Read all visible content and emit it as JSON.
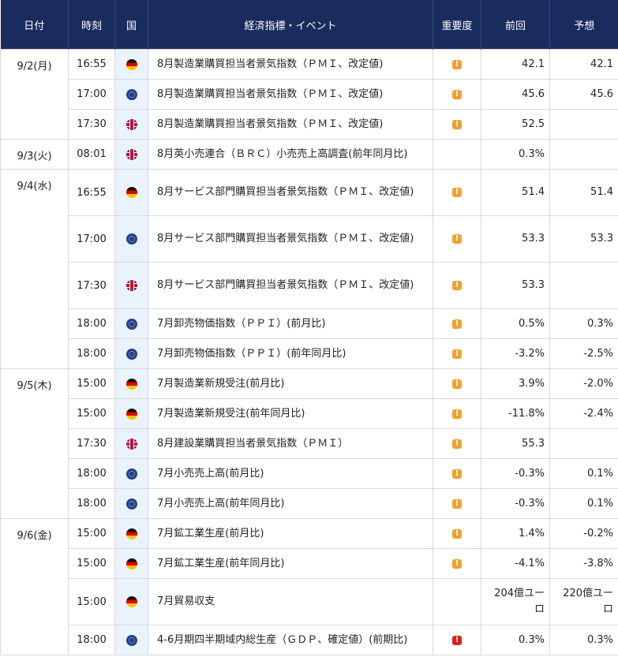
{
  "header": {
    "date": "日付",
    "time": "時刻",
    "country": "国",
    "event": "経済指標・イベント",
    "importance": "重要度",
    "previous": "前回",
    "forecast": "予想"
  },
  "importance_glyph": "!",
  "colors": {
    "header_bg": "#1a2b5e",
    "flag_column_bg": "#eaf3fb",
    "importance_medium": "#f0a030",
    "importance_high": "#e0201a"
  },
  "days": [
    {
      "date": "9/2(月)",
      "rows": [
        {
          "time": "16:55",
          "country": "germany-flag-icon",
          "event": "8月製造業購買担当者景気指数（ＰＭＩ、改定値)",
          "importance": "medium",
          "previous": "42.1",
          "forecast": "42.1"
        },
        {
          "time": "17:00",
          "country": "eu-flag-icon",
          "event": "8月製造業購買担当者景気指数（ＰＭＩ、改定値)",
          "importance": "medium",
          "previous": "45.6",
          "forecast": "45.6"
        },
        {
          "time": "17:30",
          "country": "uk-flag-icon",
          "event": "8月製造業購買担当者景気指数（ＰＭＩ、改定値)",
          "importance": "medium",
          "previous": "52.5",
          "forecast": ""
        }
      ]
    },
    {
      "date": "9/3(火)",
      "rows": [
        {
          "time": "08:01",
          "country": "uk-flag-icon",
          "event": "8月英小売連合（ＢＲＣ）小売売上高調査(前年同月比)",
          "importance": "",
          "previous": "0.3%",
          "forecast": ""
        }
      ]
    },
    {
      "date": "9/4(水)",
      "rows": [
        {
          "time": "16:55",
          "country": "germany-flag-icon",
          "event": "8月サービス部門購買担当者景気指数（ＰＭＩ、改定値)",
          "importance": "medium",
          "previous": "51.4",
          "forecast": "51.4"
        },
        {
          "time": "17:00",
          "country": "eu-flag-icon",
          "event": "8月サービス部門購買担当者景気指数（ＰＭＩ、改定値)",
          "importance": "medium",
          "previous": "53.3",
          "forecast": "53.3"
        },
        {
          "time": "17:30",
          "country": "uk-flag-icon",
          "event": "8月サービス部門購買担当者景気指数（ＰＭＩ、改定値)",
          "importance": "medium",
          "previous": "53.3",
          "forecast": ""
        },
        {
          "time": "18:00",
          "country": "eu-flag-icon",
          "event": "7月卸売物価指数（ＰＰＩ）(前月比)",
          "importance": "medium",
          "previous": "0.5%",
          "forecast": "0.3%"
        },
        {
          "time": "18:00",
          "country": "eu-flag-icon",
          "event": "7月卸売物価指数（ＰＰＩ）(前年同月比)",
          "importance": "medium",
          "previous": "-3.2%",
          "forecast": "-2.5%"
        }
      ]
    },
    {
      "date": "9/5(木)",
      "rows": [
        {
          "time": "15:00",
          "country": "germany-flag-icon",
          "event": "7月製造業新規受注(前月比)",
          "importance": "medium",
          "previous": "3.9%",
          "forecast": "-2.0%"
        },
        {
          "time": "15:00",
          "country": "germany-flag-icon",
          "event": "7月製造業新規受注(前年同月比)",
          "importance": "medium",
          "previous": "-11.8%",
          "forecast": "-2.4%"
        },
        {
          "time": "17:30",
          "country": "uk-flag-icon",
          "event": "8月建設業購買担当者景気指数（ＰＭＩ）",
          "importance": "medium",
          "previous": "55.3",
          "forecast": ""
        },
        {
          "time": "18:00",
          "country": "eu-flag-icon",
          "event": "7月小売売上高(前月比)",
          "importance": "medium",
          "previous": "-0.3%",
          "forecast": "0.1%"
        },
        {
          "time": "18:00",
          "country": "eu-flag-icon",
          "event": "7月小売売上高(前年同月比)",
          "importance": "medium",
          "previous": "-0.3%",
          "forecast": "0.1%"
        }
      ]
    },
    {
      "date": "9/6(金)",
      "rows": [
        {
          "time": "15:00",
          "country": "germany-flag-icon",
          "event": "7月鉱工業生産(前月比)",
          "importance": "medium",
          "previous": "1.4%",
          "forecast": "-0.2%"
        },
        {
          "time": "15:00",
          "country": "germany-flag-icon",
          "event": "7月鉱工業生産(前年同月比)",
          "importance": "medium",
          "previous": "-4.1%",
          "forecast": "-3.8%"
        },
        {
          "time": "15:00",
          "country": "germany-flag-icon",
          "event": "7月貿易収支",
          "importance": "",
          "previous": "204億ユーロ",
          "forecast": "220億ユーロ"
        },
        {
          "time": "18:00",
          "country": "eu-flag-icon",
          "event": "4-6月期四半期域内総生産（ＧＤＰ、確定値）(前期比)",
          "importance": "high",
          "previous": "0.3%",
          "forecast": "0.3%"
        }
      ]
    }
  ]
}
